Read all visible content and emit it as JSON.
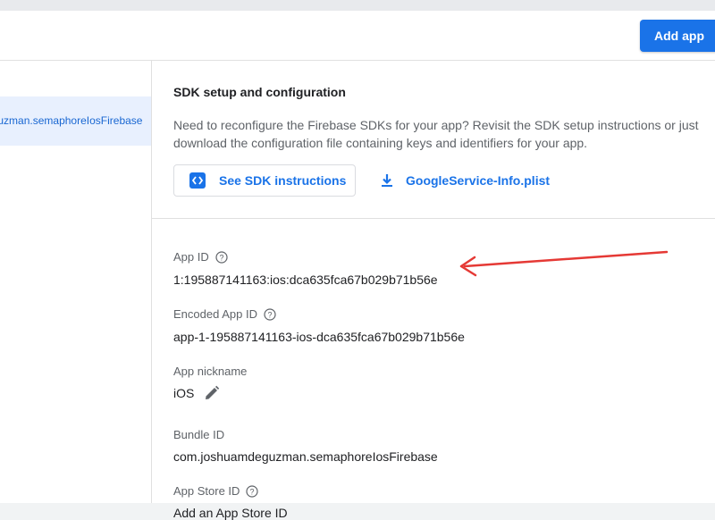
{
  "header": {
    "add_app_label": "Add app"
  },
  "sidebar": {
    "items": [
      {
        "label": "joshuamdeguzman.semaphoreIosFirebase"
      }
    ]
  },
  "sdk_section": {
    "title": "SDK setup and configuration",
    "description": "Need to reconfigure the Firebase SDKs for your app? Revisit the SDK setup instructions or just download the configuration file containing keys and identifiers for your app.",
    "sdk_button_label": "See SDK instructions",
    "download_label": "GoogleService-Info.plist"
  },
  "fields": {
    "app_id": {
      "label": "App ID",
      "value": "1:195887141163:ios:dca635fca67b029b71b56e"
    },
    "encoded_app_id": {
      "label": "Encoded App ID",
      "value": "app-1-195887141163-ios-dca635fca67b029b71b56e"
    },
    "app_nickname": {
      "label": "App nickname",
      "value": "iOS"
    },
    "bundle_id": {
      "label": "Bundle ID",
      "value": "com.joshuamdeguzman.semaphoreIosFirebase"
    },
    "app_store_id": {
      "label": "App Store ID",
      "value": "Add an App Store ID"
    }
  },
  "colors": {
    "accent": "#1a73e8",
    "selected_bg": "#e8f0fe",
    "annotation_arrow": "#e53935"
  },
  "icons": {
    "sdk": "code-icon",
    "download": "download-icon",
    "help": "help-circle-icon",
    "edit": "pencil-icon"
  }
}
